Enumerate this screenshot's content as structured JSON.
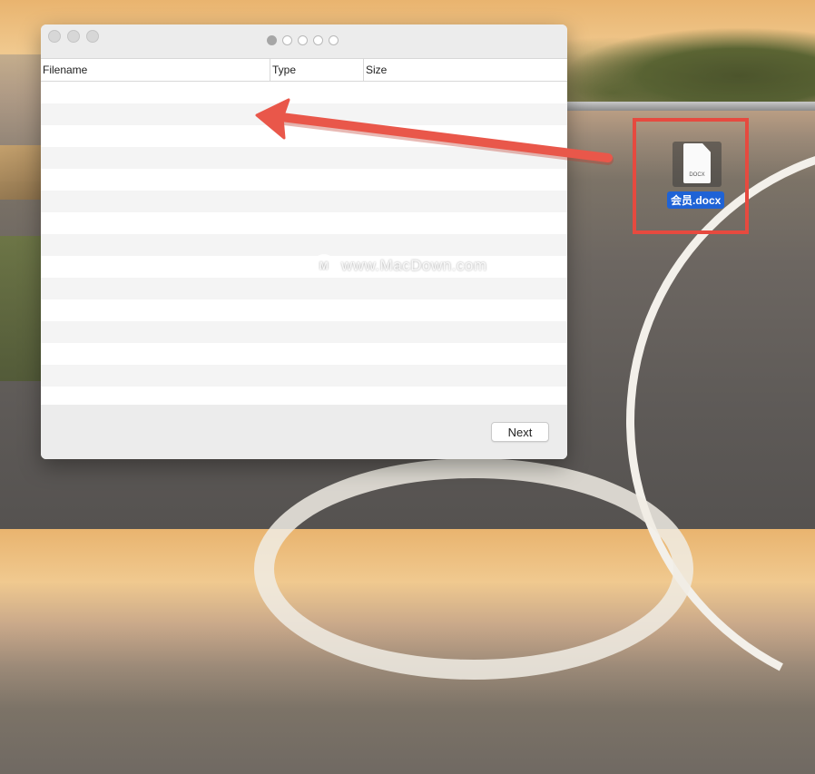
{
  "window": {
    "page_indicator": {
      "total": 5,
      "active": 0
    },
    "table": {
      "columns": [
        "Filename",
        "Type",
        "Size"
      ],
      "rows": []
    },
    "next_label": "Next"
  },
  "desktop": {
    "file": {
      "name": "会员.docx",
      "type_label": "DOCX"
    },
    "watermark": "www.MacDown.com",
    "watermark_logo": "M"
  },
  "colors": {
    "highlight": "#e64a3f",
    "arrow": "#e9574a",
    "selection": "#1f63d6"
  }
}
